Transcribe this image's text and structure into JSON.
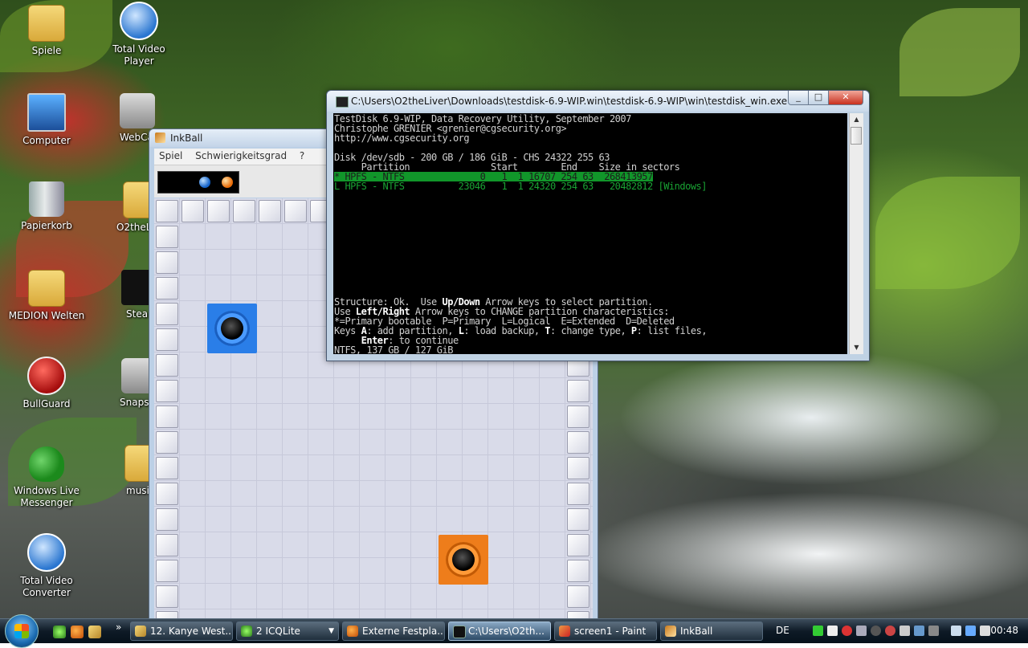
{
  "desktop": {
    "icons": [
      {
        "label": "Spiele"
      },
      {
        "label": "Total Video Player"
      },
      {
        "label": "Computer"
      },
      {
        "label": "WebCa"
      },
      {
        "label": "Papierkorb"
      },
      {
        "label": "O2theL"
      },
      {
        "label": "MEDION Welten"
      },
      {
        "label": "Stea"
      },
      {
        "label": "BullGuard"
      },
      {
        "label": "Snapsh"
      },
      {
        "label": "Windows Live Messenger"
      },
      {
        "label": "musi"
      },
      {
        "label": "Total Video Converter"
      }
    ]
  },
  "inkball": {
    "title": "InkBall",
    "menu": [
      "Spiel",
      "Schwierigkeitsgrad",
      "?"
    ]
  },
  "console": {
    "title": "C:\\Users\\O2theLiver\\Downloads\\testdisk-6.9-WIP.win\\testdisk-6.9-WIP\\win\\testdisk_win.exe",
    "lines": {
      "l1": "TestDisk 6.9-WIP, Data Recovery Utility, September 2007",
      "l2": "Christophe GRENIER <grenier@cgsecurity.org>",
      "l3": "http://www.cgsecurity.org",
      "l4": "Disk /dev/sdb - 200 GB / 186 GiB - CHS 24322 255 63",
      "l5": "     Partition               Start        End    Size in sectors",
      "l6": "* HPFS - NTFS              0   1  1 16707 254 63  268413957",
      "l7": "L HPFS - NTFS          23046   1  1 24320 254 63   20482812 [Windows]",
      "l8": "Structure: Ok.  Use ",
      "l8b": "Up/Down",
      "l8c": " Arrow keys to select partition.",
      "l9": "Use ",
      "l9b": "Left/Right",
      "l9c": " Arrow keys to CHANGE partition characteristics:",
      "l10": "*=Primary bootable  P=Primary  L=Logical  E=Extended  D=Deleted",
      "l11": "Keys ",
      "l11b": "A",
      "l11c": ": add partition, ",
      "l11d": "L",
      "l11e": ": load backup, ",
      "l11f": "T",
      "l11g": ": change type, ",
      "l11h": "P",
      "l11i": ": list files,",
      "l12": "     ",
      "l12b": "Enter",
      "l12c": ": to continue",
      "l13": "NTFS, 137 GB / 127 GiB"
    }
  },
  "taskbar": {
    "tasks": [
      {
        "label": "12. Kanye West..."
      },
      {
        "label": "2 ICQLite"
      },
      {
        "label": "Externe Festpla..."
      },
      {
        "label": "C:\\Users\\O2th..."
      },
      {
        "label": "screen1 - Paint"
      },
      {
        "label": "InkBall"
      }
    ],
    "language": "DE",
    "clock": "00:48",
    "more": "»"
  },
  "window_buttons": {
    "minimize": "_",
    "maximize": "□",
    "close": "✕"
  },
  "colors": {
    "console_highlight": "#11962a",
    "taskbar_dark": "#05101a",
    "blue_hole": "#2a7ee8",
    "orange_hole": "#ee7d1b"
  }
}
